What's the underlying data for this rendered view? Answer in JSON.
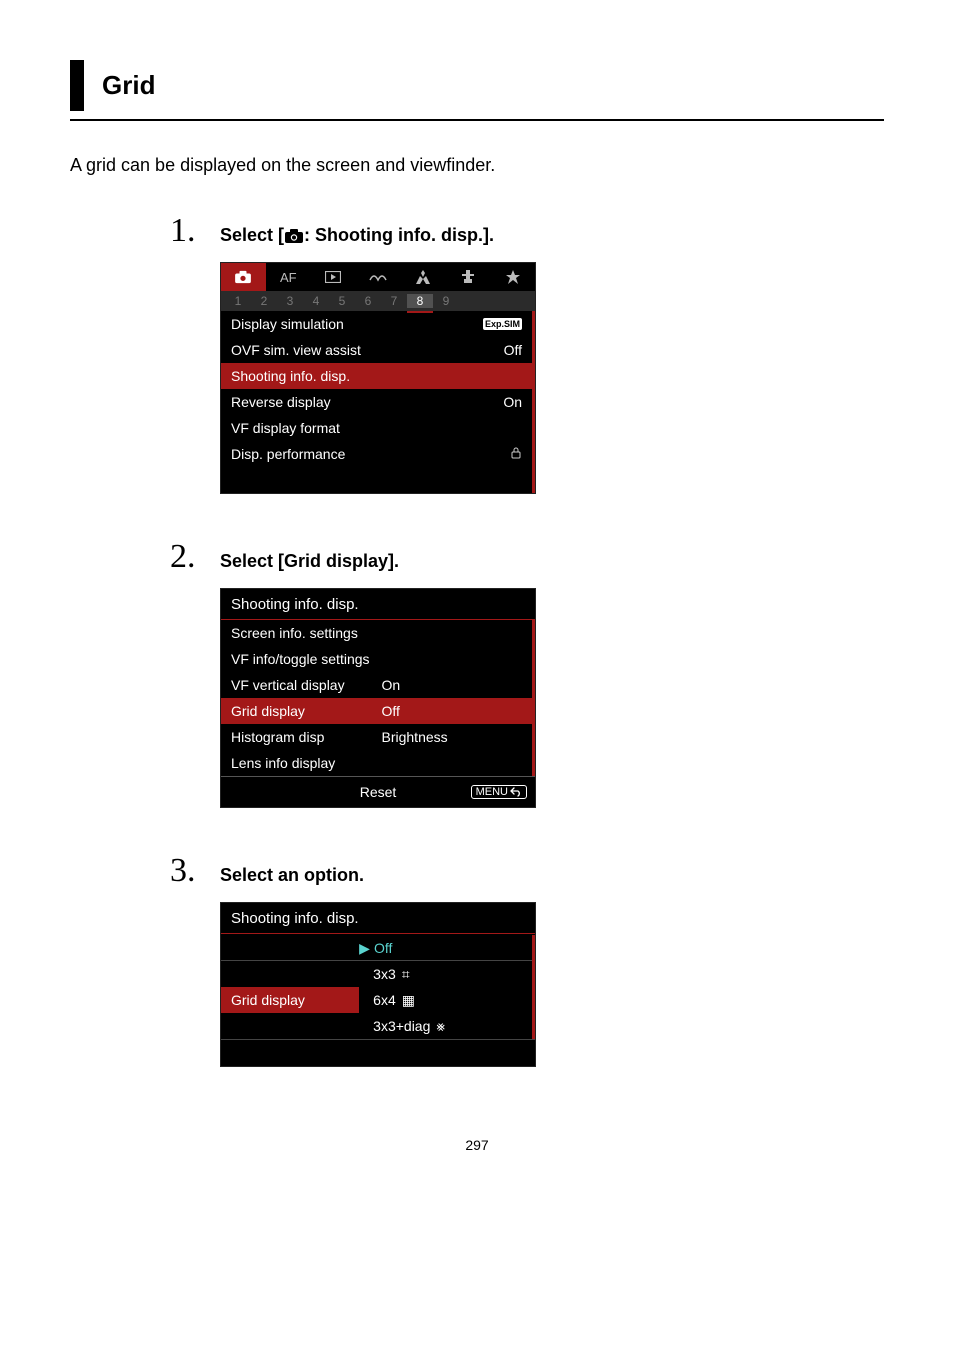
{
  "title": "Grid",
  "intro": "A grid can be displayed on the screen and viewfinder.",
  "steps": {
    "one": {
      "num": "1.",
      "title_before": "Select [",
      "title_after": ": Shooting info. disp.].",
      "menu": {
        "tabs": [
          "camera",
          "AF",
          "play",
          "wave",
          "wifi",
          "gear",
          "star"
        ],
        "pages": [
          "1",
          "2",
          "3",
          "4",
          "5",
          "6",
          "7",
          "8",
          "9"
        ],
        "active_page_index": 7,
        "rows": [
          {
            "label": "Display simulation",
            "value": "",
            "badge": "Exp.SIM"
          },
          {
            "label": "OVF sim. view assist",
            "value": "Off"
          },
          {
            "label": "Shooting info. disp.",
            "value": "",
            "selected": true
          },
          {
            "label": "Reverse display",
            "value": "On"
          },
          {
            "label": "VF display format",
            "value": ""
          },
          {
            "label": "Disp. performance",
            "value": "",
            "lock": true
          }
        ]
      }
    },
    "two": {
      "num": "2.",
      "title": "Select [Grid display].",
      "menu": {
        "header": "Shooting info. disp.",
        "rows": [
          {
            "label": "Screen info. settings",
            "value": ""
          },
          {
            "label": "VF info/toggle settings",
            "value": ""
          },
          {
            "label": "VF vertical display",
            "value": "On"
          },
          {
            "label": "Grid display",
            "value": "Off",
            "selected": true
          },
          {
            "label": "Histogram disp",
            "value": "Brightness"
          },
          {
            "label": "Lens info display",
            "value": ""
          }
        ],
        "footer_label": "Reset",
        "footer_btn": "MENU"
      }
    },
    "three": {
      "num": "3.",
      "title": "Select an option.",
      "menu": {
        "header": "Shooting info. disp.",
        "label": "Grid display",
        "options": [
          {
            "text": "Off",
            "glyph": "",
            "selected": true
          },
          {
            "text": "3x3",
            "glyph": "⌗"
          },
          {
            "text": "6x4",
            "glyph": "▦"
          },
          {
            "text": "3x3+diag",
            "glyph": "⨳"
          }
        ]
      }
    }
  },
  "page_number": "297"
}
